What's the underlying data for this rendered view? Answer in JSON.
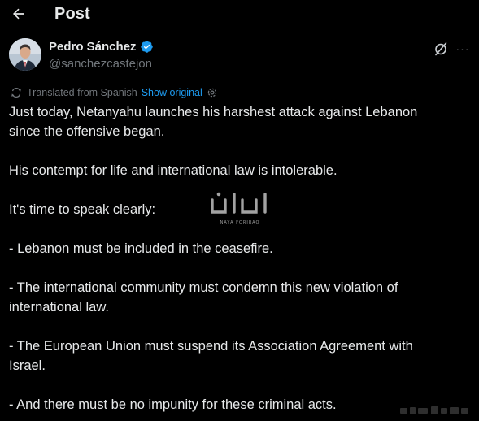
{
  "header": {
    "title": "Post",
    "back_icon": "arrow-left-icon"
  },
  "author": {
    "name": "Pedro Sánchez",
    "handle": "@sanchezcastejon",
    "verified": true,
    "verified_color": "#1d9bf0"
  },
  "actions": {
    "grok_icon": "grok-icon",
    "more_label": "···"
  },
  "translation": {
    "label": "Translated from Spanish",
    "link": "Show original"
  },
  "tweet": {
    "lines": [
      "Just today, Netanyahu launches his harshest attack against Lebanon",
      "since the offensive began.",
      "His contempt for life and international law is intolerable.",
      "It's time to speak clearly:",
      "- Lebanon must be included in the ceasefire.",
      "- The international community must condemn this new violation of",
      "international law.",
      "- The European Union must suspend its Association Agreement with",
      "Israel.",
      "- And there must be no impunity for these criminal acts."
    ]
  },
  "watermark": {
    "subtext": "NAYA FORIRAQ"
  },
  "colors": {
    "background": "#000000",
    "text": "#e7e9ea",
    "muted": "#71767b",
    "accent": "#1d9bf0"
  }
}
